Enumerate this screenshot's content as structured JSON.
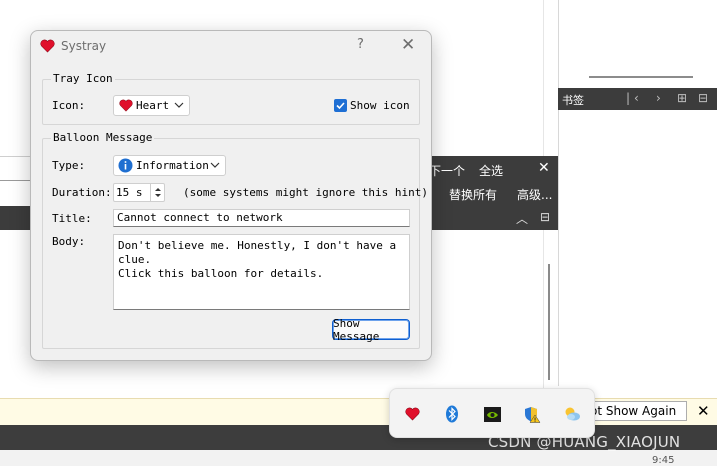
{
  "background": {
    "bookmarks_label": "书签",
    "find_prev": "下一个",
    "select_all": "全选",
    "replace_all": "替换所有",
    "advanced": "高级...",
    "not_show_again": "ot Show Again",
    "watermark": "CSDN @HUANG_XIAOJUN",
    "time": "9:45"
  },
  "tray_icons": [
    "heart-icon",
    "bluetooth-icon",
    "nvidia-icon",
    "shield-warning-icon",
    "weather-icon"
  ],
  "dialog": {
    "title": "Systray",
    "help": "?",
    "tray_group": {
      "title": "Tray Icon",
      "icon_label": "Icon:",
      "icon_value": "Heart",
      "show_icon_label": "Show icon",
      "show_icon_checked": true
    },
    "balloon_group": {
      "title": "Balloon Message",
      "type_label": "Type:",
      "type_value": "Information",
      "duration_label": "Duration:",
      "duration_value": "15 s",
      "duration_hint": "(some systems might ignore this hint)",
      "title_label": "Title:",
      "title_value": "Cannot connect to network",
      "body_label": "Body:",
      "body_value": "Don't believe me. Honestly, I don't have a clue.\nClick this balloon for details.",
      "show_button": "Show Message"
    }
  },
  "colors": {
    "accent": "#1e6fd4",
    "heart": "#e0102b",
    "dark_toolbar": "#3c3c3c"
  }
}
